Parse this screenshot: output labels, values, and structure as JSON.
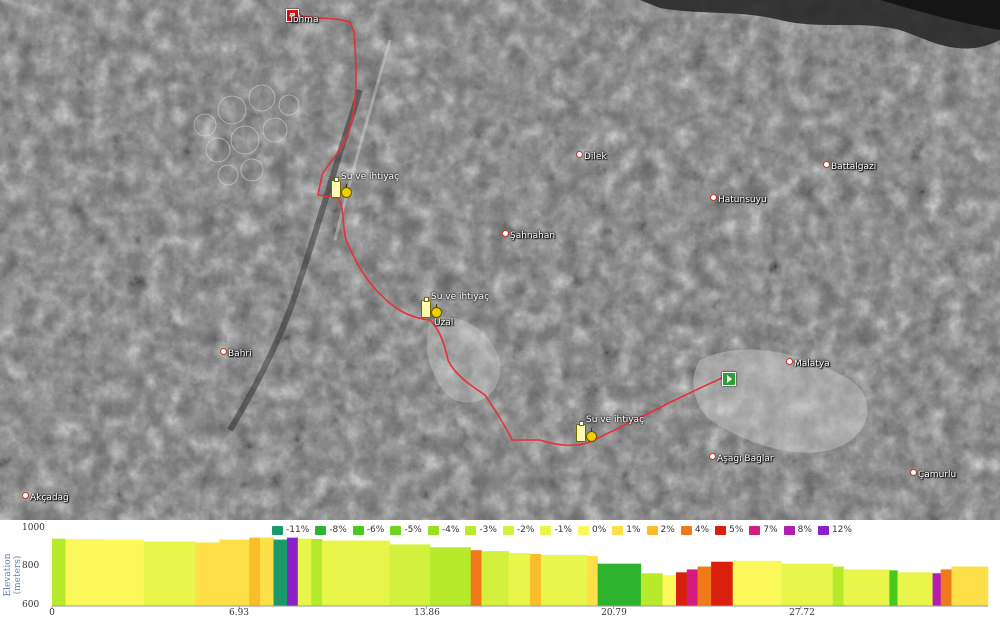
{
  "places": [
    {
      "id": "tohma",
      "name": "Tohma"
    },
    {
      "id": "dilek",
      "name": "Dilek"
    },
    {
      "id": "battalgazi",
      "name": "Battalgazi"
    },
    {
      "id": "hatunsuyu",
      "name": "Hatunsuyu"
    },
    {
      "id": "sahnahan",
      "name": "Şahnahan"
    },
    {
      "id": "uzal",
      "name": "Uzal"
    },
    {
      "id": "bahri",
      "name": "Bahri"
    },
    {
      "id": "malatya",
      "name": "Malatya"
    },
    {
      "id": "asagi_baglar",
      "name": "Aşağı Bağlar"
    },
    {
      "id": "camurlu",
      "name": "Çamurlu"
    },
    {
      "id": "akcadag",
      "name": "Akçadağ"
    }
  ],
  "waypoints": [
    {
      "id": "wp1",
      "label": "Su ve ihtiyaç"
    },
    {
      "id": "wp2",
      "label": "Su ve ihtiyaç"
    },
    {
      "id": "wp3",
      "label": "Su ve ihtiyaç"
    }
  ],
  "colors": {
    "route": "#e8303a",
    "start_marker": "#2e9e3a",
    "end_marker": "#d11111"
  },
  "elevation": {
    "ylabel": "Elevation (meters)",
    "yticks": [
      "1000",
      "800",
      "600"
    ],
    "ylim": [
      600,
      1000
    ],
    "xticks": [
      "0",
      "6.93",
      "13.86",
      "20.79",
      "27.72"
    ],
    "xlim": [
      0,
      34.65
    ],
    "legend": [
      {
        "label": "-11%",
        "color": "#1a9a6a"
      },
      {
        "label": "-8%",
        "color": "#2db32d"
      },
      {
        "label": "-6%",
        "color": "#47c91e"
      },
      {
        "label": "-5%",
        "color": "#6fd61e"
      },
      {
        "label": "-4%",
        "color": "#97e021"
      },
      {
        "label": "-3%",
        "color": "#b6ea2b"
      },
      {
        "label": "-2%",
        "color": "#d2f03c"
      },
      {
        "label": "-1%",
        "color": "#e8f54a"
      },
      {
        "label": "0%",
        "color": "#faf85a"
      },
      {
        "label": "1%",
        "color": "#fde047"
      },
      {
        "label": "2%",
        "color": "#fbbd2a"
      },
      {
        "label": "4%",
        "color": "#f07a1a"
      },
      {
        "label": "5%",
        "color": "#d8200c"
      },
      {
        "label": "7%",
        "color": "#d41c7e"
      },
      {
        "label": "8%",
        "color": "#b41cb4"
      },
      {
        "label": "12%",
        "color": "#8a20c8"
      }
    ]
  },
  "chart_data": {
    "type": "area",
    "xlabel": "",
    "ylabel": "Elevation (meters)",
    "xlim": [
      0,
      34.65
    ],
    "ylim": [
      600,
      1000
    ],
    "grid": false,
    "segments": [
      {
        "x0": 0.0,
        "x1": 0.5,
        "y": 950,
        "grade": "-3%"
      },
      {
        "x0": 0.5,
        "x1": 1.9,
        "y": 948,
        "grade": "0%"
      },
      {
        "x0": 1.9,
        "x1": 3.4,
        "y": 945,
        "grade": "0%"
      },
      {
        "x0": 3.4,
        "x1": 5.3,
        "y": 935,
        "grade": "-1%"
      },
      {
        "x0": 5.3,
        "x1": 6.2,
        "y": 930,
        "grade": "1%"
      },
      {
        "x0": 6.2,
        "x1": 7.3,
        "y": 945,
        "grade": "1%"
      },
      {
        "x0": 7.3,
        "x1": 7.7,
        "y": 955,
        "grade": "2%"
      },
      {
        "x0": 7.7,
        "x1": 8.2,
        "y": 955,
        "grade": "1%"
      },
      {
        "x0": 8.2,
        "x1": 8.7,
        "y": 945,
        "grade": "-11%"
      },
      {
        "x0": 8.7,
        "x1": 9.1,
        "y": 955,
        "grade": "12%"
      },
      {
        "x0": 9.1,
        "x1": 9.6,
        "y": 950,
        "grade": "-1%"
      },
      {
        "x0": 9.6,
        "x1": 10.0,
        "y": 948,
        "grade": "-3%"
      },
      {
        "x0": 10.0,
        "x1": 12.5,
        "y": 940,
        "grade": "-1%"
      },
      {
        "x0": 12.5,
        "x1": 14.0,
        "y": 920,
        "grade": "-2%"
      },
      {
        "x0": 14.0,
        "x1": 15.5,
        "y": 905,
        "grade": "-3%"
      },
      {
        "x0": 15.5,
        "x1": 15.9,
        "y": 890,
        "grade": "4%"
      },
      {
        "x0": 15.9,
        "x1": 16.9,
        "y": 885,
        "grade": "-2%"
      },
      {
        "x0": 16.9,
        "x1": 17.7,
        "y": 875,
        "grade": "-1%"
      },
      {
        "x0": 17.7,
        "x1": 18.1,
        "y": 870,
        "grade": "2%"
      },
      {
        "x0": 18.1,
        "x1": 19.8,
        "y": 865,
        "grade": "-1%"
      },
      {
        "x0": 19.8,
        "x1": 20.2,
        "y": 860,
        "grade": "1%"
      },
      {
        "x0": 20.2,
        "x1": 21.8,
        "y": 820,
        "grade": "-8%"
      },
      {
        "x0": 21.8,
        "x1": 22.6,
        "y": 770,
        "grade": "-3%"
      },
      {
        "x0": 22.6,
        "x1": 23.1,
        "y": 760,
        "grade": "0%"
      },
      {
        "x0": 23.1,
        "x1": 23.5,
        "y": 775,
        "grade": "5%"
      },
      {
        "x0": 23.5,
        "x1": 23.9,
        "y": 790,
        "grade": "7%"
      },
      {
        "x0": 23.9,
        "x1": 24.4,
        "y": 805,
        "grade": "4%"
      },
      {
        "x0": 24.4,
        "x1": 25.2,
        "y": 830,
        "grade": "5%"
      },
      {
        "x0": 25.2,
        "x1": 27.0,
        "y": 835,
        "grade": "0%"
      },
      {
        "x0": 27.0,
        "x1": 28.9,
        "y": 820,
        "grade": "-1%"
      },
      {
        "x0": 28.9,
        "x1": 29.3,
        "y": 805,
        "grade": "-3%"
      },
      {
        "x0": 29.3,
        "x1": 31.0,
        "y": 790,
        "grade": "-1%"
      },
      {
        "x0": 31.0,
        "x1": 31.3,
        "y": 785,
        "grade": "-6%"
      },
      {
        "x0": 31.3,
        "x1": 32.6,
        "y": 775,
        "grade": "-1%"
      },
      {
        "x0": 32.6,
        "x1": 32.9,
        "y": 770,
        "grade": "8%"
      },
      {
        "x0": 32.9,
        "x1": 33.3,
        "y": 790,
        "grade": "4%"
      },
      {
        "x0": 33.3,
        "x1": 34.65,
        "y": 805,
        "grade": "1%"
      }
    ]
  }
}
